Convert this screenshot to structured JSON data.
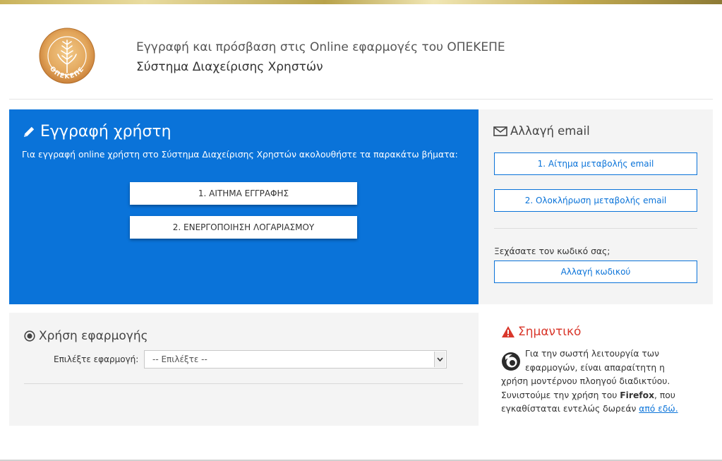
{
  "header": {
    "line1": "Εγγραφή και πρόσβαση στις Online εφαρμογές του ΟΠΕΚΕΠΕ",
    "line2": "Σύστημα Διαχείρισης Χρηστών",
    "logo_text": "ΟΠΕΚΕΠΕ"
  },
  "registration": {
    "icon": "pencil-icon",
    "title": "Εγγραφή χρήστη",
    "description": "Για εγγραφή online χρήστη στο Σύστημα Διαχείρισης Χρηστών ακολουθήστε τα παρακάτω βήματα:",
    "button1": "1. ΑΙΤΗΜΑ ΕΓΓΡΑΦΗΣ",
    "button2": "2. ΕΝΕΡΓΟΠΟΙΗΣΗ ΛΟΓΑΡΙΑΣΜΟΥ"
  },
  "email_change": {
    "icon": "envelope-icon",
    "title": "Αλλαγή email",
    "button1": "1. Αίτημα μεταβολής email",
    "button2": "2. Ολοκλήρωση μεταβολής email",
    "forgot_question": "Ξεχάσατε τον κωδικό σας;",
    "password_button": "Αλλαγή κωδικού"
  },
  "application": {
    "icon": "target-icon",
    "title": "Χρήση εφαρμογής",
    "select_label": "Επιλέξτε εφαρμογή:",
    "select_value": "-- Επιλέξτε --"
  },
  "important": {
    "icon": "warning-icon",
    "title": "Σημαντικό",
    "text_part1": "Για την σωστή λειτουργία των εφαρμογών, είναι απαραίτητη η χρήση μοντέρνου πλοηγού διαδικτύου. Συνιστούμε την χρήση του ",
    "browser_name": "Firefox",
    "text_part2": ", που εγκαθίσταται εντελώς δωρεάν ",
    "link_text": "από εδώ."
  },
  "colors": {
    "primary": "#0a73d9",
    "panel_bg": "#f4f4f4",
    "danger": "#d9372b"
  }
}
